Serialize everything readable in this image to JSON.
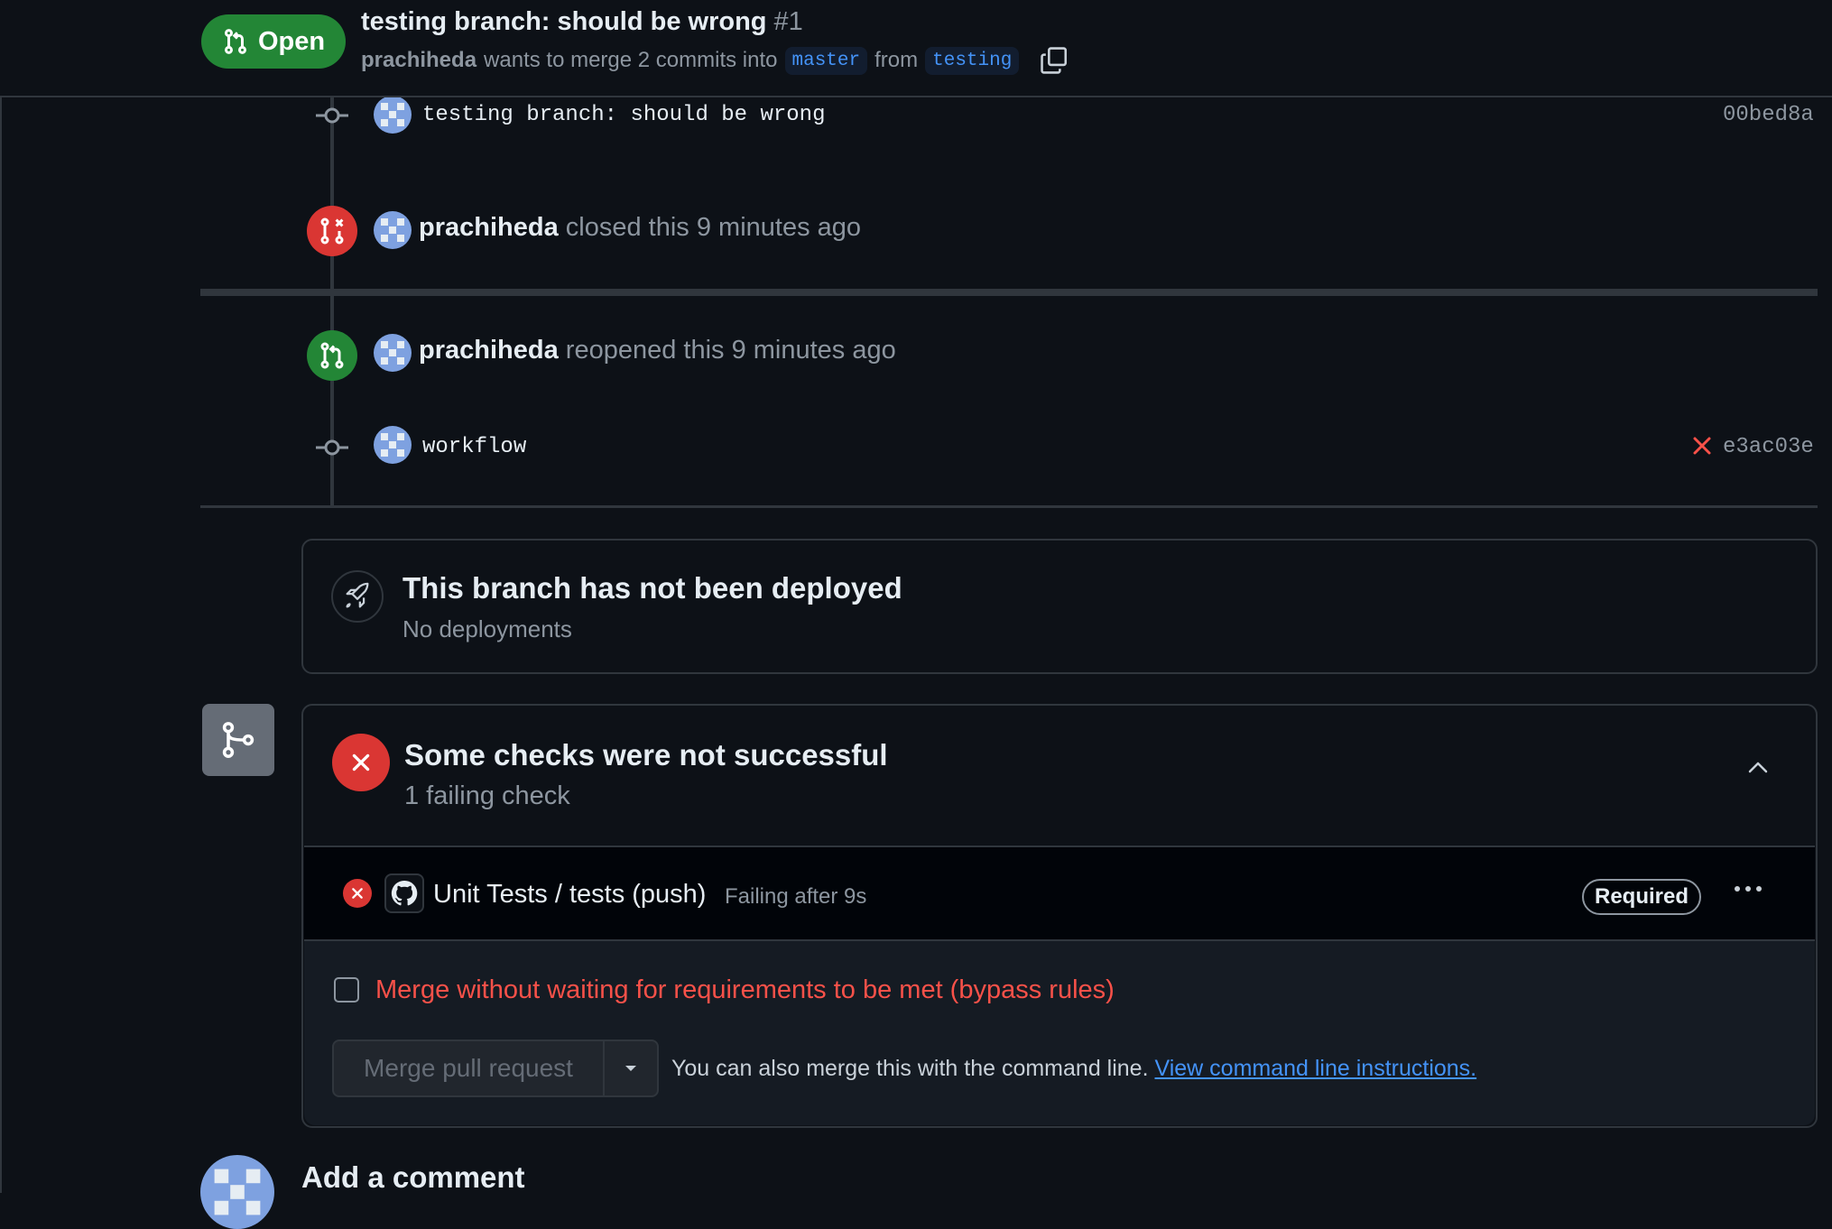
{
  "header": {
    "state": "Open",
    "title": "testing branch: should be wrong",
    "number": "#1",
    "author": "prachiheda",
    "merge_text": "wants to merge 2 commits into",
    "base_branch": "master",
    "from_text": "from",
    "head_branch": "testing"
  },
  "timeline": {
    "commit1": {
      "message": "testing branch: should be wrong",
      "sha": "00bed8a"
    },
    "closed": {
      "user": "prachiheda",
      "text": "closed this 9 minutes ago"
    },
    "reopened": {
      "user": "prachiheda",
      "text": "reopened this 9 minutes ago"
    },
    "commit2": {
      "message": "workflow",
      "sha": "e3ac03e",
      "status": "failed"
    }
  },
  "deploy": {
    "title": "This branch has not been deployed",
    "subtitle": "No deployments"
  },
  "checks": {
    "title": "Some checks were not successful",
    "subtitle": "1 failing check",
    "items": [
      {
        "name": "Unit Tests / tests (push)",
        "status": "Failing after 9s",
        "badge": "Required"
      }
    ]
  },
  "merge": {
    "bypass_label": "Merge without waiting for requirements to be met (bypass rules)",
    "button_label": "Merge pull request",
    "cli_text": "You can also merge this with the command line.",
    "cli_link": "View command line instructions."
  },
  "comment": {
    "heading": "Add a comment"
  },
  "colors": {
    "open": "#238636",
    "closed": "#da3633",
    "accent": "#4493f8",
    "danger": "#f85149"
  }
}
